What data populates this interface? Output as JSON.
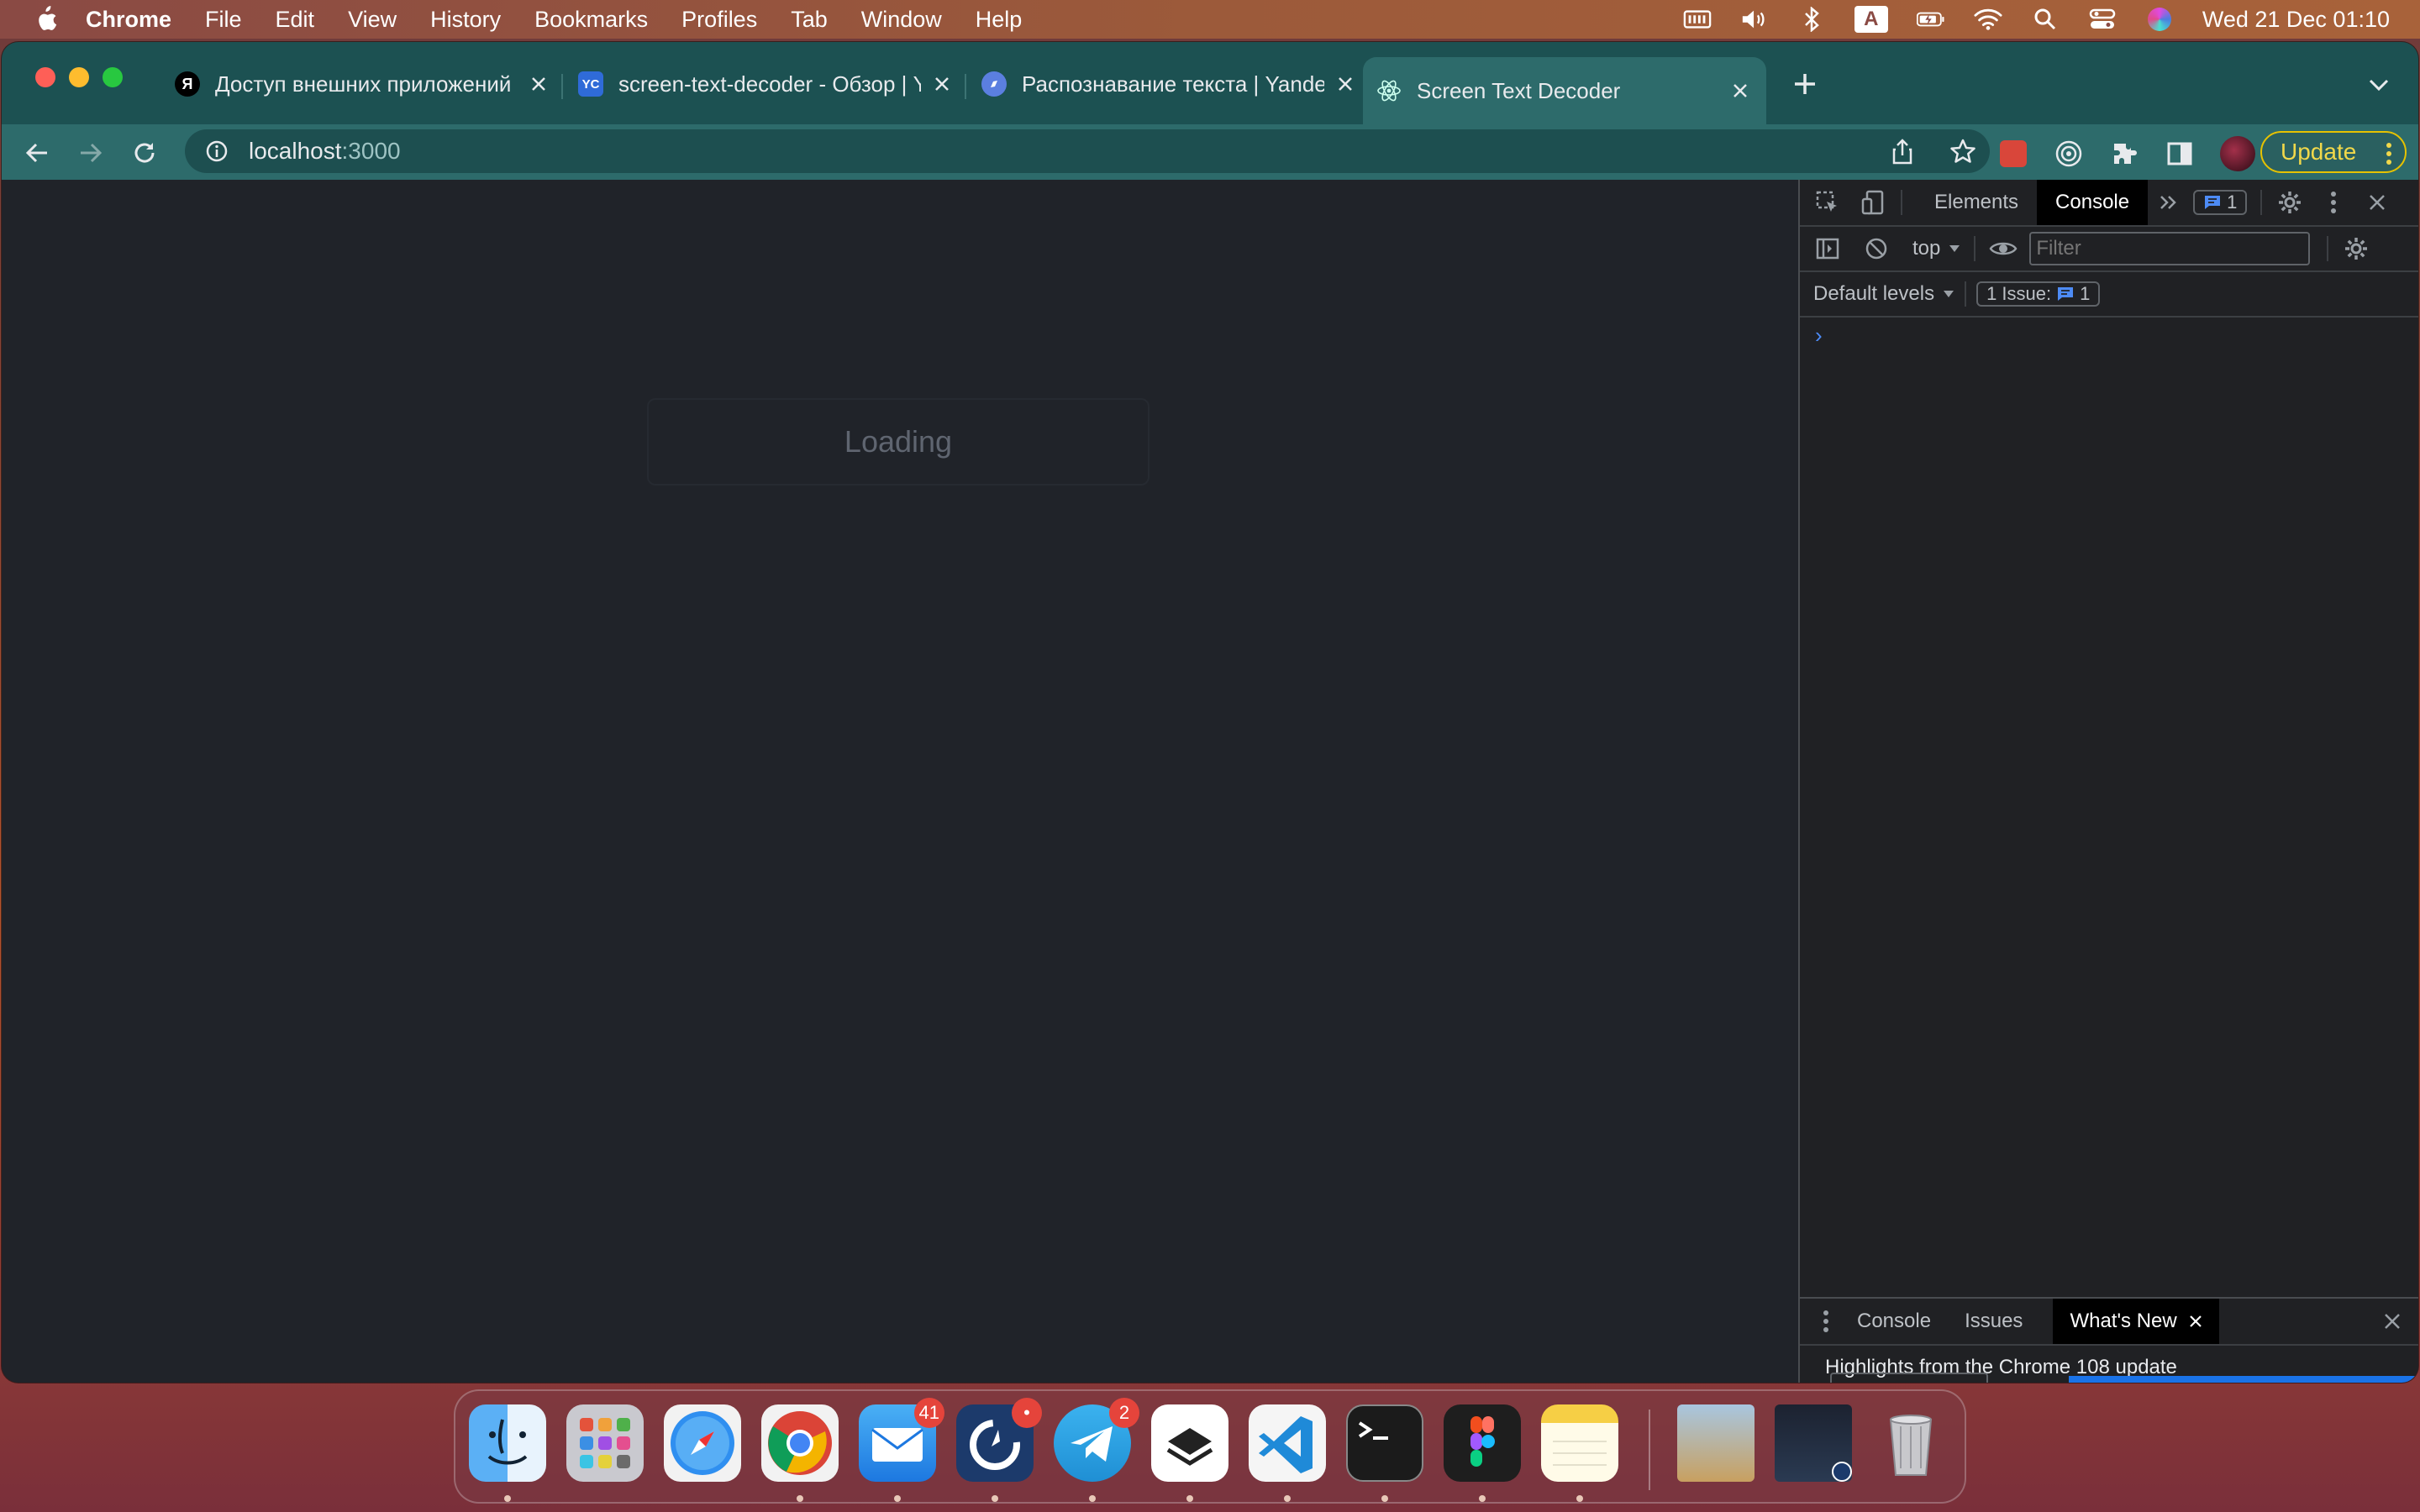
{
  "menubar": {
    "app_name": "Chrome",
    "items": [
      "File",
      "Edit",
      "View",
      "History",
      "Bookmarks",
      "Profiles",
      "Tab",
      "Window",
      "Help"
    ],
    "keyboard_layout": "A",
    "clock": "Wed 21 Dec  01:10"
  },
  "tabs": [
    {
      "title": "Доступ внешних приложений",
      "favicon": "yandex-icon",
      "favicon_text": "Я",
      "favicon_color": "#000000",
      "active": false
    },
    {
      "title": "screen-text-decoder - Обзор | Y",
      "favicon": "yandex-cloud-icon",
      "favicon_text": "YC",
      "favicon_color": "#2f6bd8",
      "active": false
    },
    {
      "title": "Распознавание текста | Yandex",
      "favicon": "compass-icon",
      "favicon_text": "",
      "favicon_color": "#5b7fe0",
      "active": false
    },
    {
      "title": "Screen Text Decoder",
      "favicon": "react-icon",
      "favicon_text": "",
      "favicon_color": "#2d6b6b",
      "active": true
    }
  ],
  "omnibox": {
    "host": "localhost",
    "port": ":3000"
  },
  "update_button": {
    "label": "Update"
  },
  "page": {
    "loading_text": "Loading"
  },
  "devtools": {
    "tabs": [
      "Elements",
      "Console"
    ],
    "active_tab": "Console",
    "issues_count": "1",
    "context": "top",
    "filter_placeholder": "Filter",
    "levels": "Default levels",
    "issue_label": "1 Issue:",
    "issue_count": "1",
    "prompt": "›",
    "drawer": {
      "tabs": [
        "Console",
        "Issues"
      ],
      "active_tab": "What's New",
      "headline": "Highlights from the Chrome 108 update"
    }
  },
  "dock": {
    "items": [
      {
        "name": "finder",
        "badge": ""
      },
      {
        "name": "launchpad",
        "badge": ""
      },
      {
        "name": "safari",
        "badge": ""
      },
      {
        "name": "chrome",
        "badge": ""
      },
      {
        "name": "mail",
        "badge": "41"
      },
      {
        "name": "mattermost",
        "badge": "•"
      },
      {
        "name": "telegram",
        "badge": "2"
      },
      {
        "name": "sublime-merge",
        "badge": ""
      },
      {
        "name": "vscode",
        "badge": ""
      },
      {
        "name": "terminal",
        "badge": ""
      },
      {
        "name": "figma",
        "badge": ""
      },
      {
        "name": "notes",
        "badge": ""
      },
      {
        "name": "preview-photos",
        "badge": ""
      },
      {
        "name": "downloads-stack",
        "badge": ""
      },
      {
        "name": "trash",
        "badge": ""
      }
    ]
  },
  "colors": {
    "tabstrip": "#1c5152",
    "toolbar": "#2d6b6b",
    "page_bg": "#202329",
    "accent_blue": "#4d8bf5",
    "update_yellow": "#f1d84a"
  }
}
